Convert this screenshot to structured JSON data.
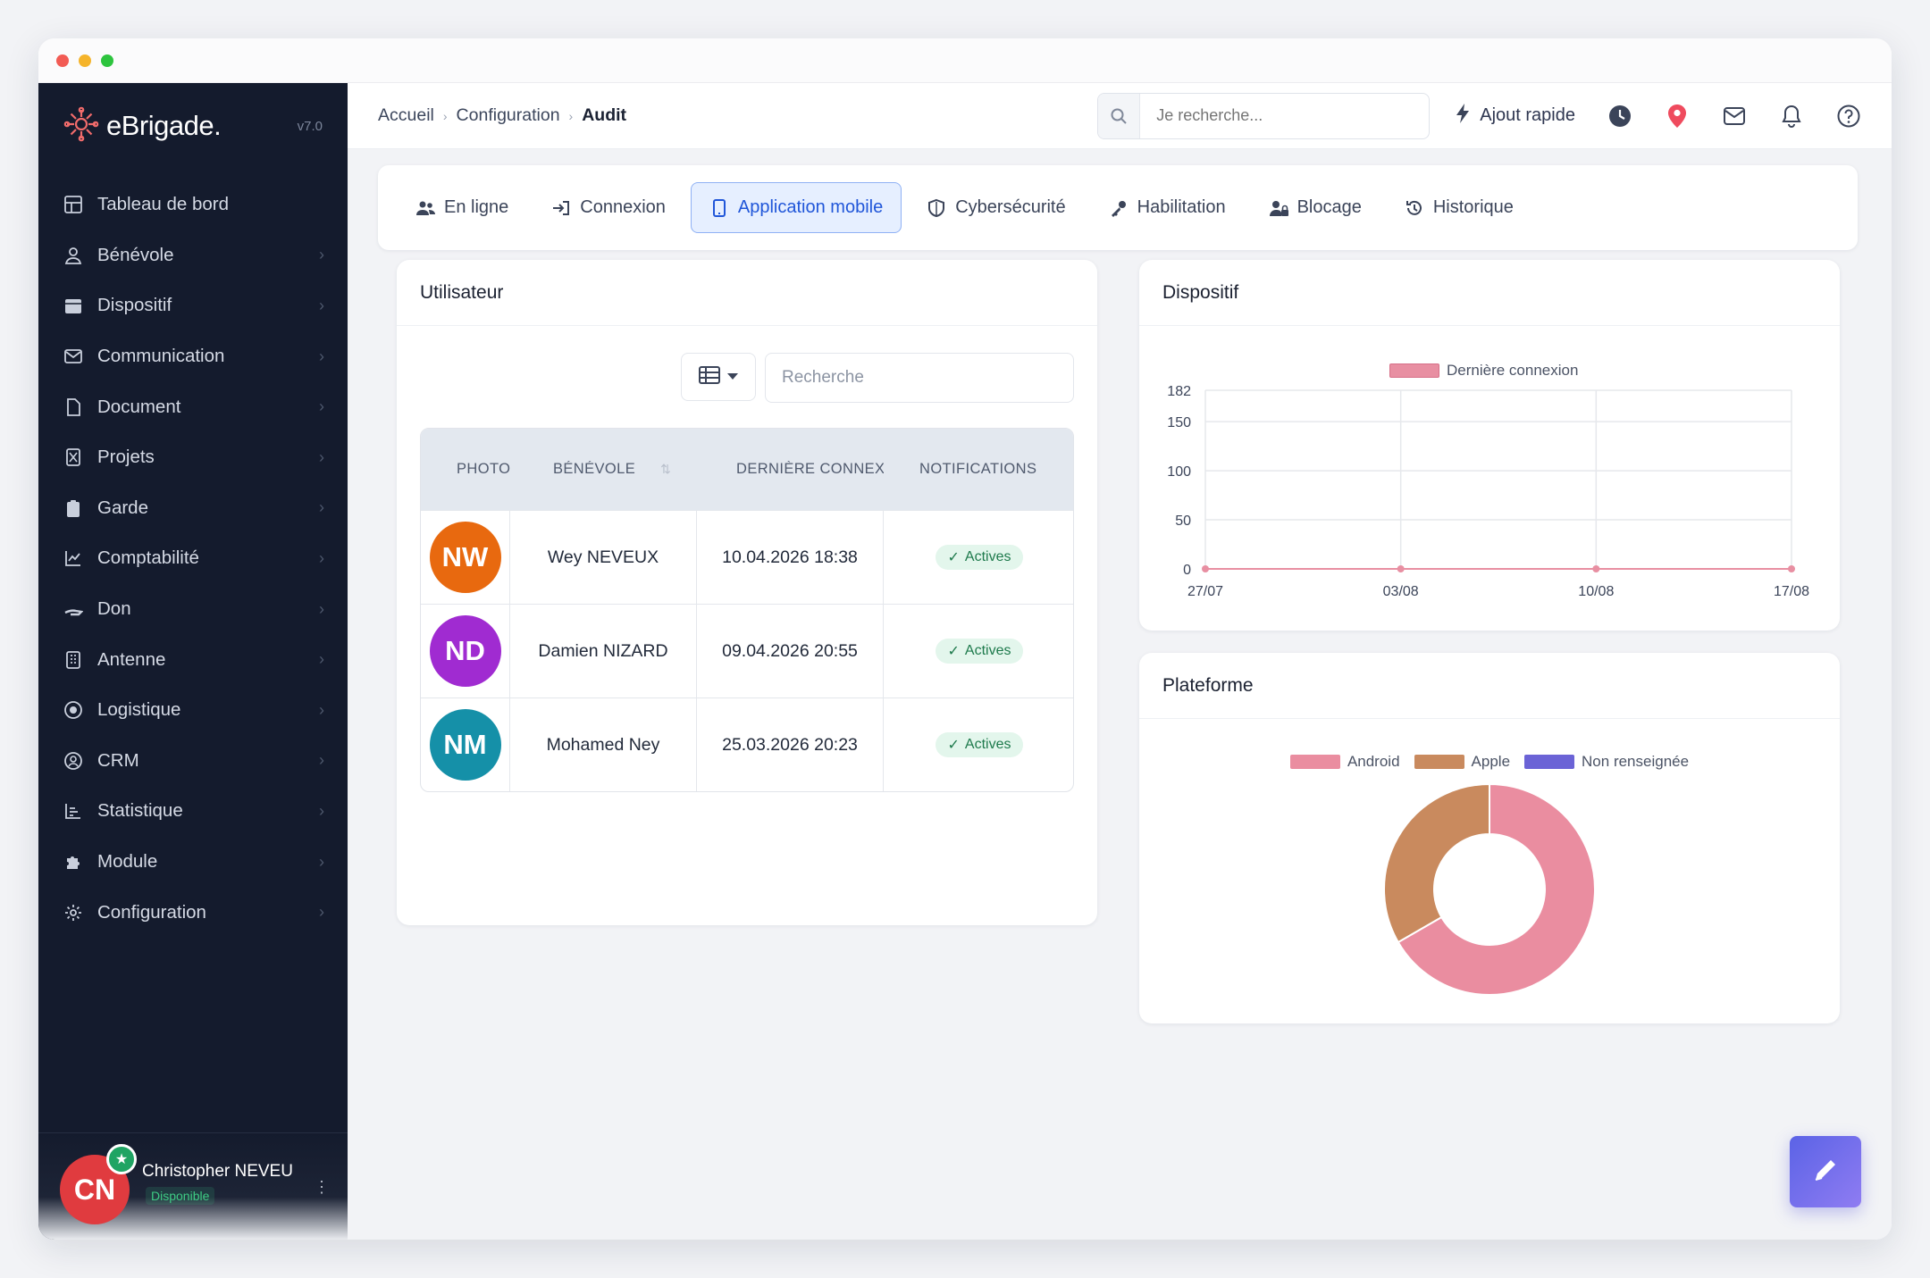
{
  "brand": {
    "name": "eBrigade.",
    "version": "v7.0"
  },
  "sidebar": {
    "items": [
      {
        "label": "Tableau de bord",
        "icon": "dashboard-icon",
        "has_children": false
      },
      {
        "label": "Bénévole",
        "icon": "user-icon",
        "has_children": true
      },
      {
        "label": "Dispositif",
        "icon": "calendar-icon",
        "has_children": true
      },
      {
        "label": "Communication",
        "icon": "mail-icon",
        "has_children": true
      },
      {
        "label": "Document",
        "icon": "document-icon",
        "has_children": true
      },
      {
        "label": "Projets",
        "icon": "project-icon",
        "has_children": true
      },
      {
        "label": "Garde",
        "icon": "clipboard-icon",
        "has_children": true
      },
      {
        "label": "Comptabilité",
        "icon": "chart-line-icon",
        "has_children": true
      },
      {
        "label": "Don",
        "icon": "hand-icon",
        "has_children": true
      },
      {
        "label": "Antenne",
        "icon": "building-icon",
        "has_children": true
      },
      {
        "label": "Logistique",
        "icon": "target-icon",
        "has_children": true
      },
      {
        "label": "CRM",
        "icon": "contact-icon",
        "has_children": true
      },
      {
        "label": "Statistique",
        "icon": "stats-icon",
        "has_children": true
      },
      {
        "label": "Module",
        "icon": "puzzle-icon",
        "has_children": true
      },
      {
        "label": "Configuration",
        "icon": "gear-icon",
        "has_children": true
      }
    ],
    "user": {
      "initials": "CN",
      "name": "Christopher NEVEU",
      "status": "Disponible"
    }
  },
  "topbar": {
    "breadcrumb": [
      "Accueil",
      "Configuration",
      "Audit"
    ],
    "search_placeholder": "Je recherche...",
    "quick_add": "Ajout rapide"
  },
  "tabs": [
    {
      "label": "En ligne",
      "icon": "users-icon",
      "active": false
    },
    {
      "label": "Connexion",
      "icon": "login-icon",
      "active": false
    },
    {
      "label": "Application mobile",
      "icon": "mobile-icon",
      "active": true
    },
    {
      "label": "Cybersécurité",
      "icon": "shield-icon",
      "active": false
    },
    {
      "label": "Habilitation",
      "icon": "key-icon",
      "active": false
    },
    {
      "label": "Blocage",
      "icon": "user-lock-icon",
      "active": false
    },
    {
      "label": "Historique",
      "icon": "history-icon",
      "active": false
    }
  ],
  "utilisateur": {
    "title": "Utilisateur",
    "search_placeholder": "Recherche",
    "columns": [
      "PHOTO",
      "BÉNÉVOLE",
      "DERNIÈRE CONNEXION",
      "NOTIFICATIONS"
    ],
    "rows": [
      {
        "initials": "NW",
        "color": "#e8690f",
        "name": "Wey NEVEUX",
        "last": "10.04.2026 18:38",
        "notif": "Actives"
      },
      {
        "initials": "ND",
        "color": "#a02bd1",
        "name": "Damien NIZARD",
        "last": "09.04.2026 20:55",
        "notif": "Actives"
      },
      {
        "initials": "NM",
        "color": "#1590a8",
        "name": "Mohamed Ney",
        "last": "25.03.2026 20:23",
        "notif": "Actives"
      }
    ]
  },
  "dispositif": {
    "title": "Dispositif"
  },
  "plateforme": {
    "title": "Plateforme"
  },
  "chart_data": [
    {
      "type": "line",
      "legend": [
        "Dernière connexion"
      ],
      "categories": [
        "27/07",
        "03/08",
        "10/08",
        "17/08"
      ],
      "series": [
        {
          "name": "Dernière connexion",
          "values": [
            0,
            0,
            0,
            0
          ],
          "color": "#e88fa2"
        }
      ],
      "y_ticks": [
        0,
        50,
        100,
        150,
        182
      ],
      "ylim": [
        0,
        182
      ],
      "grid": true
    },
    {
      "type": "pie",
      "style": "doughnut",
      "labels": [
        "Android",
        "Apple",
        "Non renseignée"
      ],
      "values": [
        2,
        1,
        0
      ],
      "colors": [
        "#ea8da0",
        "#c98a5e",
        "#6b63d6"
      ]
    }
  ],
  "colors": {
    "sidebar_bg": "#141b2d",
    "accent": "#2056d9"
  }
}
